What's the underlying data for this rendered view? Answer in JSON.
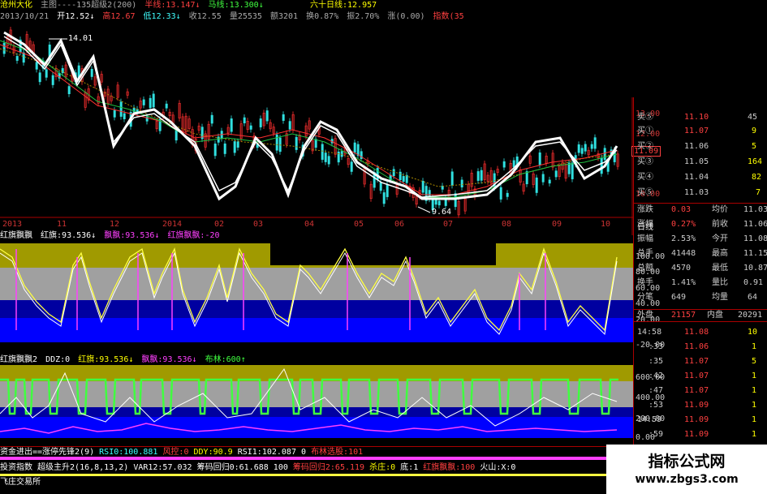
{
  "header": {
    "stock_name": "沧州大化",
    "main_label": "主图----135超级2(200)",
    "ma_half": "半线:13.147↓",
    "ma_horse": "马线:13.300↓",
    "ma_sixty": "六十日线:12.957",
    "date": "2013/10/21",
    "open": "开12.52↓",
    "high": "高12.67",
    "low": "低12.33↓",
    "close": "收12.55",
    "volume": "量25535",
    "amount": "额3201",
    "turnover": "换0.87%",
    "amplitude": "振2.70%",
    "change": "涨(0.00)",
    "index": "指数(35"
  },
  "main_chart": {
    "price_high_label": "14.01",
    "price_low_label": "9.64",
    "current_price": "11.09",
    "y_axis": [
      "13.00",
      "12.00",
      "11.00",
      "10.00"
    ],
    "x_axis": [
      "2013",
      "11",
      "12",
      "2014",
      "02",
      "03",
      "04",
      "05",
      "06",
      "07",
      "08",
      "09",
      "10"
    ],
    "x_axis_title": "日线"
  },
  "indicator1": {
    "title": "红旗飘飘",
    "values": "红旗:93.536↓",
    "piao": "飘飘:93.536↓",
    "hongqi_piao": "红旗飘飘:-20",
    "y_axis": [
      "100.00",
      "80.00",
      "60.00",
      "40.00",
      "20.00",
      "-20.00"
    ]
  },
  "indicator2": {
    "title": "红旗飘飘2",
    "ddz": "DDZ:0",
    "hongqi": "红旗:93.536↓",
    "piaopiao": "飘飘:93.536↓",
    "bulin": "布林:600↑",
    "y_axis": [
      "600.00",
      "400.00",
      "200.00",
      "0.00"
    ]
  },
  "bottom": {
    "row1": [
      "资金进出==涨停先锋2(9)",
      "RSI0:100.881",
      "风控:0",
      "DDY:90.9",
      "RSI1:102.087",
      "0",
      "布林选股:101"
    ],
    "row2": [
      "投资指数",
      "超级主升2(16,8,13,2)",
      "VAR12:57.032",
      "筹码回归0:61.688",
      "100",
      "筹码回归2:65.119",
      "杀庄:0",
      "底:1",
      "红旗飘飘:100",
      "火山:X:0"
    ],
    "row3": "飞庄交易所"
  },
  "order_book": {
    "header": [
      "卖⑤",
      "11.10",
      "45"
    ],
    "bids": [
      {
        "label": "买①",
        "price": "11.07",
        "vol": "9"
      },
      {
        "label": "买②",
        "price": "11.06",
        "vol": "5"
      },
      {
        "label": "买③",
        "price": "11.05",
        "vol": "164"
      },
      {
        "label": "买④",
        "price": "11.04",
        "vol": "82"
      },
      {
        "label": "买⑤",
        "price": "11.03",
        "vol": "7"
      }
    ],
    "stats": [
      {
        "k1": "涨跌",
        "v1": "0.03",
        "k2": "均价",
        "v2": "11.03"
      },
      {
        "k1": "涨幅",
        "v1": "0.27%",
        "k2": "前收",
        "v2": "11.06"
      },
      {
        "k1": "振幅",
        "v1": "2.53%",
        "k2": "今开",
        "v2": "11.08"
      },
      {
        "k1": "总手",
        "v1": "41448",
        "k2": "最高",
        "v2": "11.15"
      },
      {
        "k1": "总额",
        "v1": "4570",
        "k2": "最低",
        "v2": "10.87"
      },
      {
        "k1": "换手",
        "v1": "1.41%",
        "k2": "量比",
        "v2": "0.91"
      },
      {
        "k1": "分笔",
        "v1": "649",
        "k2": "均量",
        "v2": "64"
      }
    ],
    "outer": "外盘",
    "outer_val": "21157",
    "inner": "内盘",
    "inner_val": "20291",
    "ticks": [
      {
        "t": "14:58",
        "p": "11.08",
        "v": "10"
      },
      {
        "t": ":33",
        "p": "11.06",
        "v": "1"
      },
      {
        "t": ":35",
        "p": "11.07",
        "v": "5"
      },
      {
        "t": ":42",
        "p": "11.07",
        "v": "1"
      },
      {
        "t": ":47",
        "p": "11.07",
        "v": "1"
      },
      {
        "t": ":53",
        "p": "11.09",
        "v": "1"
      },
      {
        "t": "14:59",
        "p": "11.09",
        "v": "1"
      },
      {
        "t": ":59",
        "p": "11.09",
        "v": "1"
      }
    ]
  },
  "watermark": {
    "title": "指标公式网",
    "url": "www.zbgs3.com"
  }
}
